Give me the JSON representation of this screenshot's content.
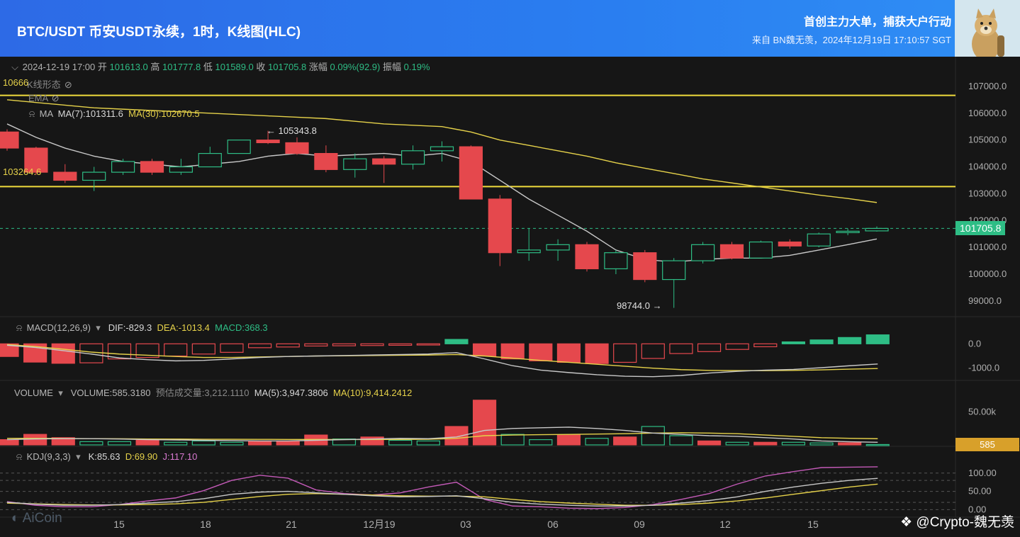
{
  "header": {
    "title": "BTC/USDT 币安USDT永续，1时，K线图(HLC)",
    "right_line1": "首创主力大单，捕获大户行动",
    "right_line2": "来自 BN魏无羡，2024年12月19日 17:10:57 SGT"
  },
  "ohlc": {
    "date": "2024-12-19 17:00",
    "open_label": "开",
    "open": "101613.0",
    "high_label": "高",
    "high": "101777.8",
    "low_label": "低",
    "low": "101589.0",
    "close_label": "收",
    "close": "101705.8",
    "change_label": "涨幅",
    "change": "0.09%(92.9)",
    "amp_label": "振幅",
    "amp": "0.19%"
  },
  "indicators": {
    "kline_shape": "K线形态",
    "ema": "EMA",
    "ma_label": "MA",
    "ma7": "MA(7):101311.6",
    "ma30": "MA(30):102670.5",
    "macd_label": "MACD(12,26,9)",
    "dif": "DIF:-829.3",
    "dea": "DEA:-1013.4",
    "macd": "MACD:368.3",
    "volume_label": "VOLUME",
    "volume": "VOLUME:585.3180",
    "est_volume": "预估成交量:3,212.1110",
    "vol_ma5": "MA(5):3,947.3806",
    "vol_ma10": "MA(10):9,414.2412",
    "kdj_label": "KDJ(9,3,3)",
    "k": "K:85.63",
    "d": "D:69.90",
    "j": "J:117.10"
  },
  "annotations": {
    "high_marker": "← 105343.8",
    "low_marker": "98744.0 →",
    "line_upper": "10666",
    "line_lower": "103264.6",
    "price_tag": "101705.8",
    "volume_tag": "585"
  },
  "branding": {
    "aicoin": "AiCoin",
    "watermark": "@Crypto-魏无羡"
  },
  "colors": {
    "up": "#2ebd85",
    "down": "#e5484d",
    "ma7": "#c8c8c8",
    "ma30": "#e6d24a",
    "hline": "#f0dc3c",
    "kdj_j": "#c45ab8",
    "background": "#161616"
  },
  "chart_data": {
    "type": "candlestick",
    "title": "BTC/USDT 币安USDT永续，1时，K线图(HLC)",
    "x_tick_labels": [
      "15",
      "18",
      "21",
      "12月19",
      "03",
      "06",
      "09",
      "12",
      "15"
    ],
    "y_tick_labels": [
      "107000.0",
      "106000.0",
      "105000.0",
      "104000.0",
      "103000.0",
      "102000.0",
      "101000.0",
      "100000.0",
      "99000.0"
    ],
    "ylim": [
      98600,
      107500
    ],
    "horizontal_lines": [
      106666,
      103264.6
    ],
    "candles": [
      {
        "o": 105300,
        "c": 104700,
        "h": 105400,
        "l": 104600
      },
      {
        "o": 104700,
        "c": 103800,
        "h": 104750,
        "l": 103700
      },
      {
        "o": 103800,
        "c": 103500,
        "h": 104100,
        "l": 103400
      },
      {
        "o": 103500,
        "c": 103800,
        "h": 104000,
        "l": 103100
      },
      {
        "o": 103800,
        "c": 104200,
        "h": 104300,
        "l": 103700
      },
      {
        "o": 104200,
        "c": 103800,
        "h": 104300,
        "l": 103700
      },
      {
        "o": 103800,
        "c": 104000,
        "h": 104300,
        "l": 103700
      },
      {
        "o": 104000,
        "c": 104500,
        "h": 104750,
        "l": 104000
      },
      {
        "o": 104500,
        "c": 105000,
        "h": 105000,
        "l": 104500
      },
      {
        "o": 105000,
        "c": 104900,
        "h": 105343.8,
        "l": 104850
      },
      {
        "o": 104900,
        "c": 104500,
        "h": 105100,
        "l": 104450
      },
      {
        "o": 104500,
        "c": 103900,
        "h": 104800,
        "l": 103800
      },
      {
        "o": 103900,
        "c": 104300,
        "h": 104500,
        "l": 103600
      },
      {
        "o": 104300,
        "c": 104100,
        "h": 104400,
        "l": 103400
      },
      {
        "o": 104100,
        "c": 104600,
        "h": 104800,
        "l": 103900
      },
      {
        "o": 104600,
        "c": 104750,
        "h": 104950,
        "l": 104200
      },
      {
        "o": 104750,
        "c": 102800,
        "h": 104800,
        "l": 102800
      },
      {
        "o": 102800,
        "c": 100800,
        "h": 102950,
        "l": 100300
      },
      {
        "o": 100800,
        "c": 100900,
        "h": 101700,
        "l": 100500
      },
      {
        "o": 100900,
        "c": 101100,
        "h": 101300,
        "l": 100500
      },
      {
        "o": 101100,
        "c": 100200,
        "h": 101200,
        "l": 100100
      },
      {
        "o": 100200,
        "c": 100800,
        "h": 100900,
        "l": 100000
      },
      {
        "o": 100800,
        "c": 99800,
        "h": 100900,
        "l": 99700
      },
      {
        "o": 99800,
        "c": 100500,
        "h": 100600,
        "l": 98744.0
      },
      {
        "o": 100500,
        "c": 101100,
        "h": 101200,
        "l": 100400
      },
      {
        "o": 101100,
        "c": 100600,
        "h": 101200,
        "l": 100550
      },
      {
        "o": 100600,
        "c": 101200,
        "h": 101250,
        "l": 100600
      },
      {
        "o": 101200,
        "c": 101050,
        "h": 101300,
        "l": 100950
      },
      {
        "o": 101050,
        "c": 101500,
        "h": 101550,
        "l": 101000
      },
      {
        "o": 101550,
        "c": 101600,
        "h": 101700,
        "l": 101450
      },
      {
        "o": 101613.0,
        "c": 101705.8,
        "h": 101777.8,
        "l": 101589.0
      }
    ],
    "ma7": [
      105600,
      105100,
      104700,
      104400,
      104200,
      104100,
      104000,
      104100,
      104200,
      104400,
      104500,
      104400,
      104450,
      104500,
      104400,
      104500,
      104200,
      103500,
      102800,
      102200,
      101600,
      100900,
      100550,
      100450,
      100550,
      100600,
      100600,
      100700,
      100900,
      101100,
      101311.6
    ],
    "ma30": [
      106500,
      106400,
      106300,
      106200,
      106150,
      106100,
      106050,
      106000,
      105950,
      105900,
      105850,
      105800,
      105700,
      105600,
      105550,
      105500,
      105300,
      105000,
      104800,
      104600,
      104400,
      104150,
      103950,
      103750,
      103550,
      103400,
      103250,
      103100,
      102950,
      102820,
      102670.5
    ],
    "macd": {
      "ylim": [
        -1300,
        300
      ],
      "y_tick_labels": [
        "0.0",
        "-1000.0"
      ],
      "hist": [
        -520,
        -750,
        -800,
        -780,
        -620,
        -560,
        -500,
        -420,
        -350,
        -160,
        -130,
        -90,
        -80,
        -70,
        -60,
        -50,
        180,
        -500,
        -620,
        -700,
        -760,
        -810,
        -760,
        -600,
        -400,
        -320,
        -230,
        -120,
        80,
        160,
        260,
        368.3
      ],
      "dif": [
        -60,
        -150,
        -280,
        -420,
        -580,
        -650,
        -700,
        -680,
        -620,
        -560,
        -520,
        -500,
        -480,
        -460,
        -440,
        -420,
        -360,
        -620,
        -900,
        -1080,
        -1180,
        -1270,
        -1330,
        -1350,
        -1300,
        -1200,
        -1130,
        -1080,
        -1050,
        -980,
        -900,
        -829.3
      ],
      "dea": [
        -30,
        -110,
        -220,
        -340,
        -420,
        -470,
        -520,
        -560,
        -560,
        -540,
        -520,
        -500,
        -490,
        -480,
        -470,
        -460,
        -440,
        -500,
        -590,
        -680,
        -760,
        -840,
        -920,
        -1000,
        -1060,
        -1090,
        -1100,
        -1100,
        -1090,
        -1070,
        -1040,
        -1013.4
      ]
    },
    "volume": {
      "ylim": [
        0,
        70000
      ],
      "y_tick_labels": [
        "50.00k"
      ],
      "bars": [
        8000,
        16000,
        11000,
        5000,
        5000,
        7000,
        4000,
        6000,
        4000,
        6000,
        6000,
        15000,
        9000,
        12000,
        7000,
        6000,
        28000,
        68000,
        16000,
        8000,
        15000,
        10000,
        12000,
        28000,
        14000,
        6000,
        4000,
        4000,
        4000,
        3000,
        3212.1,
        585.3
      ],
      "up": [
        false,
        false,
        false,
        true,
        true,
        false,
        true,
        true,
        true,
        false,
        false,
        false,
        true,
        false,
        true,
        true,
        false,
        false,
        true,
        true,
        false,
        true,
        false,
        true,
        true,
        false,
        true,
        false,
        true,
        true,
        false,
        true
      ],
      "ma5": [
        8000,
        9000,
        9500,
        9500,
        9000,
        8000,
        7500,
        7000,
        6500,
        6000,
        6000,
        7000,
        8000,
        9000,
        10000,
        9500,
        12000,
        22000,
        25000,
        26000,
        27000,
        25000,
        22000,
        18000,
        16000,
        14000,
        13000,
        11000,
        9000,
        6000,
        4800,
        3947.4
      ],
      "ma10": [
        10000,
        10000,
        9800,
        9500,
        9300,
        9000,
        8800,
        8600,
        8500,
        8400,
        8300,
        8200,
        8100,
        8200,
        8300,
        8500,
        10000,
        14000,
        15000,
        15500,
        16000,
        16500,
        17000,
        18000,
        18500,
        18000,
        17000,
        15000,
        13000,
        11000,
        10000,
        9414.2
      ]
    },
    "kdj": {
      "ylim": [
        -5,
        115
      ],
      "y_tick_labels": [
        "100.00",
        "50.00",
        "0.00"
      ],
      "k": [
        20,
        15,
        12,
        12,
        14,
        18,
        22,
        30,
        42,
        48,
        50,
        46,
        42,
        38,
        35,
        36,
        38,
        30,
        20,
        15,
        12,
        10,
        10,
        12,
        18,
        25,
        35,
        50,
        62,
        72,
        80,
        85.63
      ],
      "d": [
        18,
        16,
        14,
        13,
        13,
        14,
        16,
        20,
        28,
        36,
        42,
        44,
        42,
        40,
        38,
        37,
        37,
        35,
        28,
        22,
        18,
        15,
        12,
        12,
        14,
        18,
        24,
        32,
        42,
        52,
        62,
        69.9
      ],
      "j": [
        22,
        12,
        8,
        8,
        14,
        24,
        32,
        52,
        80,
        94,
        86,
        54,
        44,
        40,
        46,
        62,
        75,
        28,
        10,
        8,
        4,
        3,
        6,
        14,
        28,
        44,
        70,
        92,
        104,
        115,
        116,
        117.1
      ]
    }
  }
}
